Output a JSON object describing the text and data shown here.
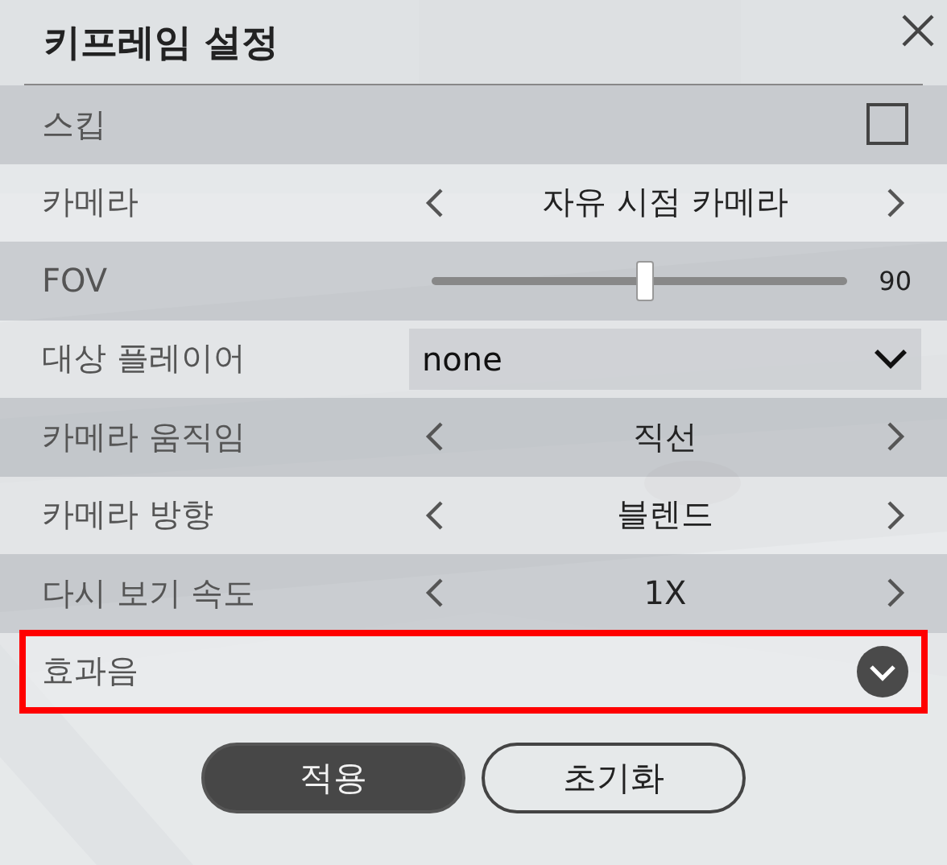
{
  "window": {
    "title": "키프레임 설정"
  },
  "rows": [
    {
      "kind": "checkbox",
      "label": "스킵",
      "checked": false,
      "highlighted": false
    },
    {
      "kind": "stepper",
      "label": "카메라",
      "value": "자유 시점 카메라",
      "highlighted": false
    },
    {
      "kind": "slider",
      "label": "FOV",
      "level": 0.51,
      "reading": "90",
      "highlighted": false
    },
    {
      "kind": "dropdown",
      "label": "대상 플레이어",
      "value": "none",
      "highlighted": false
    },
    {
      "kind": "stepper",
      "label": "카메라 움직임",
      "value": "직선",
      "highlighted": false
    },
    {
      "kind": "stepper",
      "label": "카메라 방향",
      "value": "블렌드",
      "highlighted": false
    },
    {
      "kind": "stepper",
      "label": "다시 보기 속도",
      "value": "1X",
      "highlighted": false
    },
    {
      "kind": "expand",
      "label": "효과음",
      "expanded": false,
      "highlighted": true
    }
  ],
  "buttons": [
    {
      "label": "적용",
      "primary": true
    },
    {
      "label": "초기화",
      "primary": false
    }
  ]
}
